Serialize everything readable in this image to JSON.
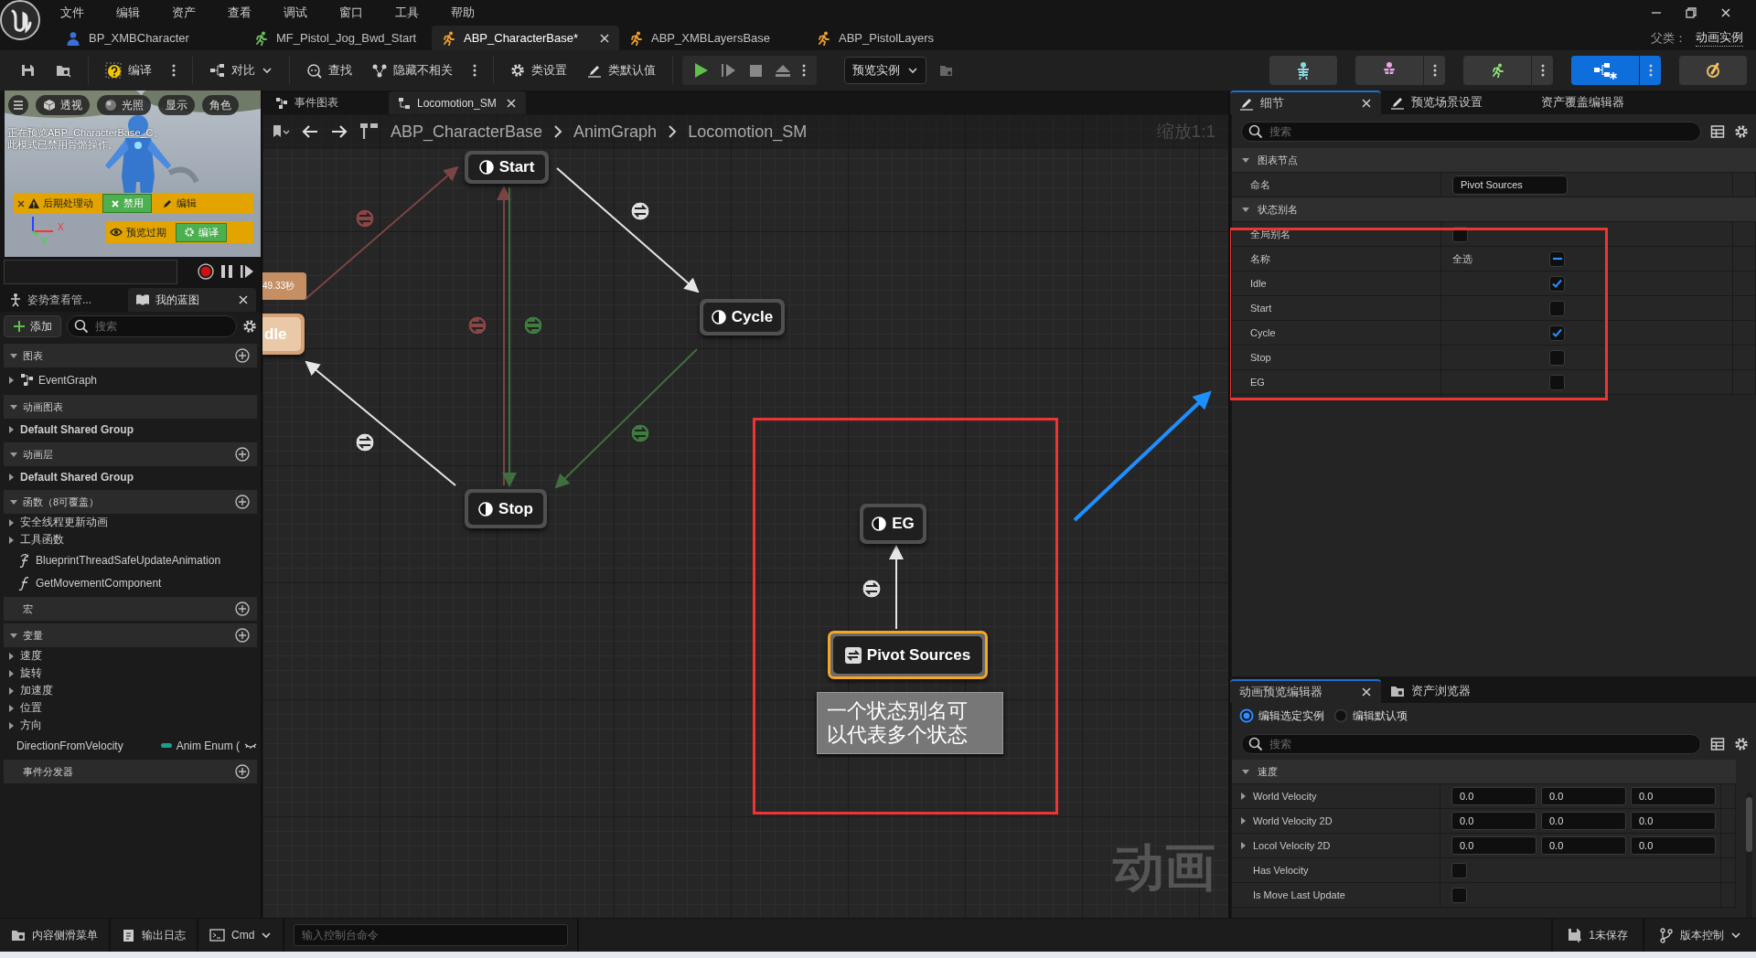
{
  "title_bar": {
    "menu": [
      "文件",
      "编辑",
      "资产",
      "查看",
      "调试",
      "窗口",
      "工具",
      "帮助"
    ],
    "tabs": [
      {
        "label": "BP_XMBCharacter",
        "kind": "blueprint",
        "selected": false
      },
      {
        "label": "MF_Pistol_Jog_Bwd_Start",
        "kind": "animation",
        "selected": false
      },
      {
        "label": "ABP_CharacterBase*",
        "kind": "anim_blueprint",
        "selected": true
      },
      {
        "label": "ABP_XMBLayersBase",
        "kind": "anim_blueprint",
        "selected": false
      },
      {
        "label": "ABP_PistolLayers",
        "kind": "anim_blueprint",
        "selected": false
      }
    ],
    "parent_label": "父类：",
    "parent_value": "动画实例"
  },
  "toolbar": {
    "tools": [
      {
        "kind": "save"
      },
      {
        "kind": "browse"
      },
      {
        "kind": "compile",
        "label": "编译"
      },
      {
        "kind": "more"
      },
      {
        "kind": "diff",
        "label": "对比"
      },
      {
        "kind": "find",
        "label": "查找"
      },
      {
        "kind": "hide",
        "label": "隐藏不相关"
      },
      {
        "kind": "more"
      },
      {
        "kind": "class_settings",
        "label": "类设置"
      },
      {
        "kind": "class_defaults",
        "label": "类默认值"
      },
      {
        "kind": "play_group"
      },
      {
        "kind": "dropdown",
        "label": "预览实例"
      },
      {
        "kind": "debug"
      }
    ],
    "modes": [
      {
        "kind": "skeleton",
        "selected": false,
        "menu": false
      },
      {
        "kind": "mesh",
        "selected": false,
        "menu": true
      },
      {
        "kind": "animation",
        "selected": false,
        "menu": true
      },
      {
        "kind": "blueprint",
        "selected": true,
        "menu": true
      },
      {
        "kind": "physics",
        "selected": false,
        "menu": false
      }
    ]
  },
  "viewport": {
    "view_buttons": [
      "透视",
      "光照",
      "显示",
      "角色"
    ],
    "notice": [
      "正在预览ABP_CharacterBase_C。",
      "此模式已禁用骨骼操作。"
    ],
    "warning": "后期处理动",
    "disable": "禁用",
    "edit": "编辑",
    "stale": "预览过期",
    "compile": "编译",
    "axes": [
      "X",
      "Y"
    ]
  },
  "left_tabs": [
    {
      "label": "姿势查看管...",
      "selected": false
    },
    {
      "label": "我的蓝图",
      "selected": true
    }
  ],
  "my_blueprint": {
    "add": "添加",
    "search_placeholder": "搜索",
    "sections": [
      {
        "title": "图表",
        "expanded": true,
        "addable": true,
        "items": [
          {
            "label": "EventGraph",
            "kind": "graph",
            "expandable": true
          }
        ]
      },
      {
        "title": "动画图表",
        "expanded": true,
        "addable": false,
        "items": [
          {
            "label": "Default Shared Group",
            "kind": "group",
            "expandable": true
          }
        ]
      },
      {
        "title": "动画层",
        "expanded": true,
        "addable": true,
        "items": [
          {
            "label": "Default Shared Group",
            "kind": "group",
            "expandable": true
          }
        ]
      },
      {
        "title": "函数（8可覆盖）",
        "expanded": true,
        "addable": true,
        "items": [
          {
            "label": "安全线程更新动画",
            "kind": "folder",
            "expandable": true
          },
          {
            "label": "工具函数",
            "kind": "folder",
            "expandable": true
          },
          {
            "label": "BlueprintThreadSafeUpdateAnimation",
            "kind": "thread_function",
            "expandable": false
          },
          {
            "label": "GetMovementComponent",
            "kind": "function",
            "expandable": false
          }
        ]
      },
      {
        "title": "宏",
        "expanded": false,
        "addable": true
      },
      {
        "title": "变量",
        "expanded": true,
        "addable": true,
        "items": [
          {
            "label": "速度",
            "kind": "folder",
            "expandable": true
          },
          {
            "label": "旋转",
            "kind": "folder",
            "expandable": true
          },
          {
            "label": "加速度",
            "kind": "folder",
            "expandable": true
          },
          {
            "label": "位置",
            "kind": "folder",
            "expandable": true
          },
          {
            "label": "方向",
            "kind": "folder",
            "expandable": true
          },
          {
            "label": "DirectionFromVelocity",
            "kind": "variable",
            "type": "Anim Enum (",
            "expandable": false
          }
        ]
      },
      {
        "title": "事件分发器",
        "expanded": false,
        "addable": true
      }
    ]
  },
  "graph": {
    "tabs": [
      {
        "label": "事件图表",
        "kind": "event_graph",
        "selected": false
      },
      {
        "label": "Locomotion_SM",
        "kind": "state_machine",
        "selected": true
      }
    ],
    "breadcrumb": [
      "ABP_CharacterBase",
      "AnimGraph",
      "Locomotion_SM"
    ],
    "zoom": "缩放1:1",
    "corner_label": "动画",
    "timer": "49.33秒",
    "nodes": [
      {
        "label": "Start",
        "kind": "state",
        "active": false,
        "selected": false
      },
      {
        "label": "dle",
        "kind": "state",
        "active": true,
        "selected": false
      },
      {
        "label": "Cycle",
        "kind": "state",
        "active": false,
        "selected": false
      },
      {
        "label": "Stop",
        "kind": "state",
        "active": false,
        "selected": false
      },
      {
        "label": "EG",
        "kind": "state",
        "active": false,
        "selected": false
      },
      {
        "label": "Pivot Sources",
        "kind": "alias",
        "active": false,
        "selected": true
      }
    ],
    "comment": "一个状态别名可以代表多个状态"
  },
  "details": {
    "tabs": [
      {
        "label": "细节",
        "kind": "details",
        "selected": true
      },
      {
        "label": "预览场景设置",
        "kind": "scene",
        "selected": false
      },
      {
        "label": "资产覆盖编辑器",
        "kind": "override",
        "selected": false
      }
    ],
    "search_placeholder": "搜索",
    "sections": [
      {
        "title": "图表节点",
        "rows": [
          {
            "kind": "text",
            "label": "命名",
            "value": "Pivot Sources"
          }
        ]
      },
      {
        "title": "状态别名",
        "rows": [
          {
            "kind": "bool",
            "label": "全局别名",
            "checked": false
          },
          {
            "kind": "select_all",
            "label": "名称",
            "value": "全选",
            "indeterminate": true
          },
          {
            "kind": "state",
            "label": "Idle",
            "checked": true
          },
          {
            "kind": "state",
            "label": "Start",
            "checked": false
          },
          {
            "kind": "state",
            "label": "Cycle",
            "checked": true
          },
          {
            "kind": "state",
            "label": "Stop",
            "checked": false
          },
          {
            "kind": "state",
            "label": "EG",
            "checked": false
          }
        ]
      }
    ]
  },
  "anim_preview": {
    "tabs": [
      {
        "label": "动画预览编辑器",
        "kind": "preview",
        "selected": true
      },
      {
        "label": "资产浏览器",
        "kind": "assets",
        "selected": false
      }
    ],
    "modes": [
      {
        "label": "编辑选定实例",
        "selected": true
      },
      {
        "label": "编辑默认项",
        "selected": false
      }
    ],
    "search_placeholder": "搜索",
    "section": "速度",
    "rows": [
      {
        "kind": "vector",
        "label": "World Velocity",
        "values": [
          "0.0",
          "0.0",
          "0.0"
        ]
      },
      {
        "kind": "vector",
        "label": "World Velocity 2D",
        "values": [
          "0.0",
          "0.0",
          "0.0"
        ]
      },
      {
        "kind": "vector",
        "label": "Locol Velocity 2D",
        "values": [
          "0.0",
          "0.0",
          "0.0"
        ]
      },
      {
        "kind": "bool",
        "label": "Has Velocity",
        "checked": false
      },
      {
        "kind": "bool",
        "label": "Is Move Last Update",
        "checked": false
      }
    ]
  },
  "status_bar": {
    "left": [
      {
        "label": "内容侧滑菜单",
        "kind": "drawer"
      },
      {
        "label": "输出日志",
        "kind": "log"
      },
      {
        "label": "Cmd",
        "kind": "cmd"
      }
    ],
    "console_placeholder": "输入控制台命令",
    "right": [
      {
        "label": "1未保存",
        "kind": "unsaved"
      },
      {
        "label": "版本控制",
        "kind": "source_control"
      }
    ]
  }
}
